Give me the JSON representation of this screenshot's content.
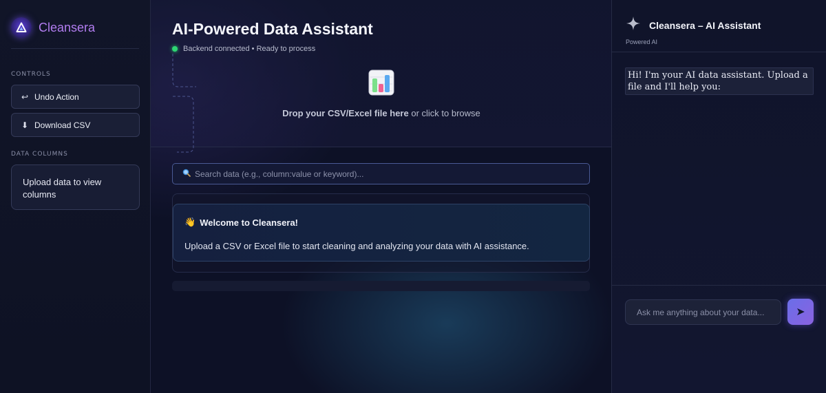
{
  "brand": {
    "name": "Cleansera",
    "logo_icon": "triangle-logo-icon"
  },
  "sidebar": {
    "controls_label": "CONTROLS",
    "undo": {
      "icon": "↩",
      "label": "Undo Action"
    },
    "download": {
      "icon": "⬇",
      "label": "Download CSV"
    },
    "columns_label": "DATA COLUMNS",
    "columns_placeholder": "Upload data to view columns"
  },
  "main": {
    "title": "AI-Powered Data Assistant",
    "status": "Backend connected • Ready to process",
    "status_color": "#2ed573",
    "drop": {
      "bold": "Drop your CSV/Excel file here",
      "rest": " or click to browse",
      "icon": "bar-chart-icon"
    },
    "search_placeholder": "Search data (e.g., column:value or keyword)...",
    "welcome": {
      "emoji": "👋",
      "title": "Welcome to Cleansera!",
      "body": "Upload a CSV or Excel file to start cleaning and analyzing your data with AI assistance."
    }
  },
  "chat": {
    "title": "Cleansera – AI Assistant",
    "subtitle": "Powered AI",
    "message": "Hi! I'm your AI data assistant. Upload a file and I'll help you:",
    "input_placeholder": "Ask me anything about your data...",
    "send_icon": "➤"
  },
  "colors": {
    "accent": "#7b66e8",
    "brand_text": "#b27df0",
    "background": "#0c1024"
  }
}
